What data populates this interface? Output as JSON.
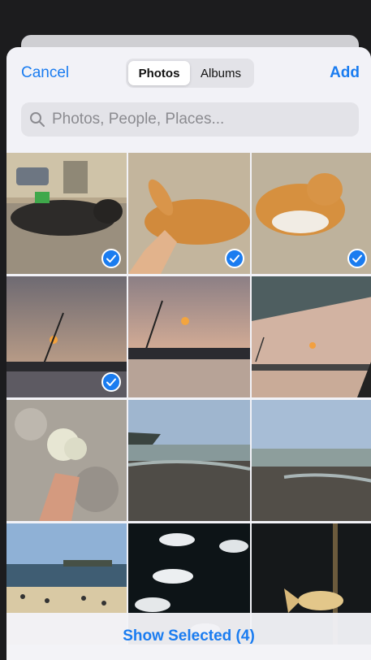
{
  "nav": {
    "cancel_label": "Cancel",
    "tabs": [
      {
        "label": "Photos",
        "active": true
      },
      {
        "label": "Albums",
        "active": false
      }
    ],
    "add_label": "Add"
  },
  "search": {
    "placeholder": "Photos, People, Places..."
  },
  "grid": {
    "rows": 4,
    "columns": 3,
    "photos": [
      {
        "subject": "black cat on ledge",
        "selected": true
      },
      {
        "subject": "orange cat petted by hand",
        "selected": true
      },
      {
        "subject": "orange cat on ground",
        "selected": true
      },
      {
        "subject": "sunset with crane",
        "selected": true
      },
      {
        "subject": "sunset over harbor",
        "selected": false
      },
      {
        "subject": "sunset from shelter",
        "selected": false
      },
      {
        "subject": "hand holding dried flower",
        "selected": false
      },
      {
        "subject": "rocky shoreline",
        "selected": false
      },
      {
        "subject": "rocky shoreline wide",
        "selected": false
      },
      {
        "subject": "beach with people",
        "selected": false
      },
      {
        "subject": "fish in aquarium",
        "selected": false
      },
      {
        "subject": "betta fish in tank",
        "selected": false
      }
    ]
  },
  "footer": {
    "show_selected_label": "Show Selected (4)"
  },
  "colors": {
    "accent": "#1a7cf0",
    "sheet_bg": "#f2f2f7"
  }
}
